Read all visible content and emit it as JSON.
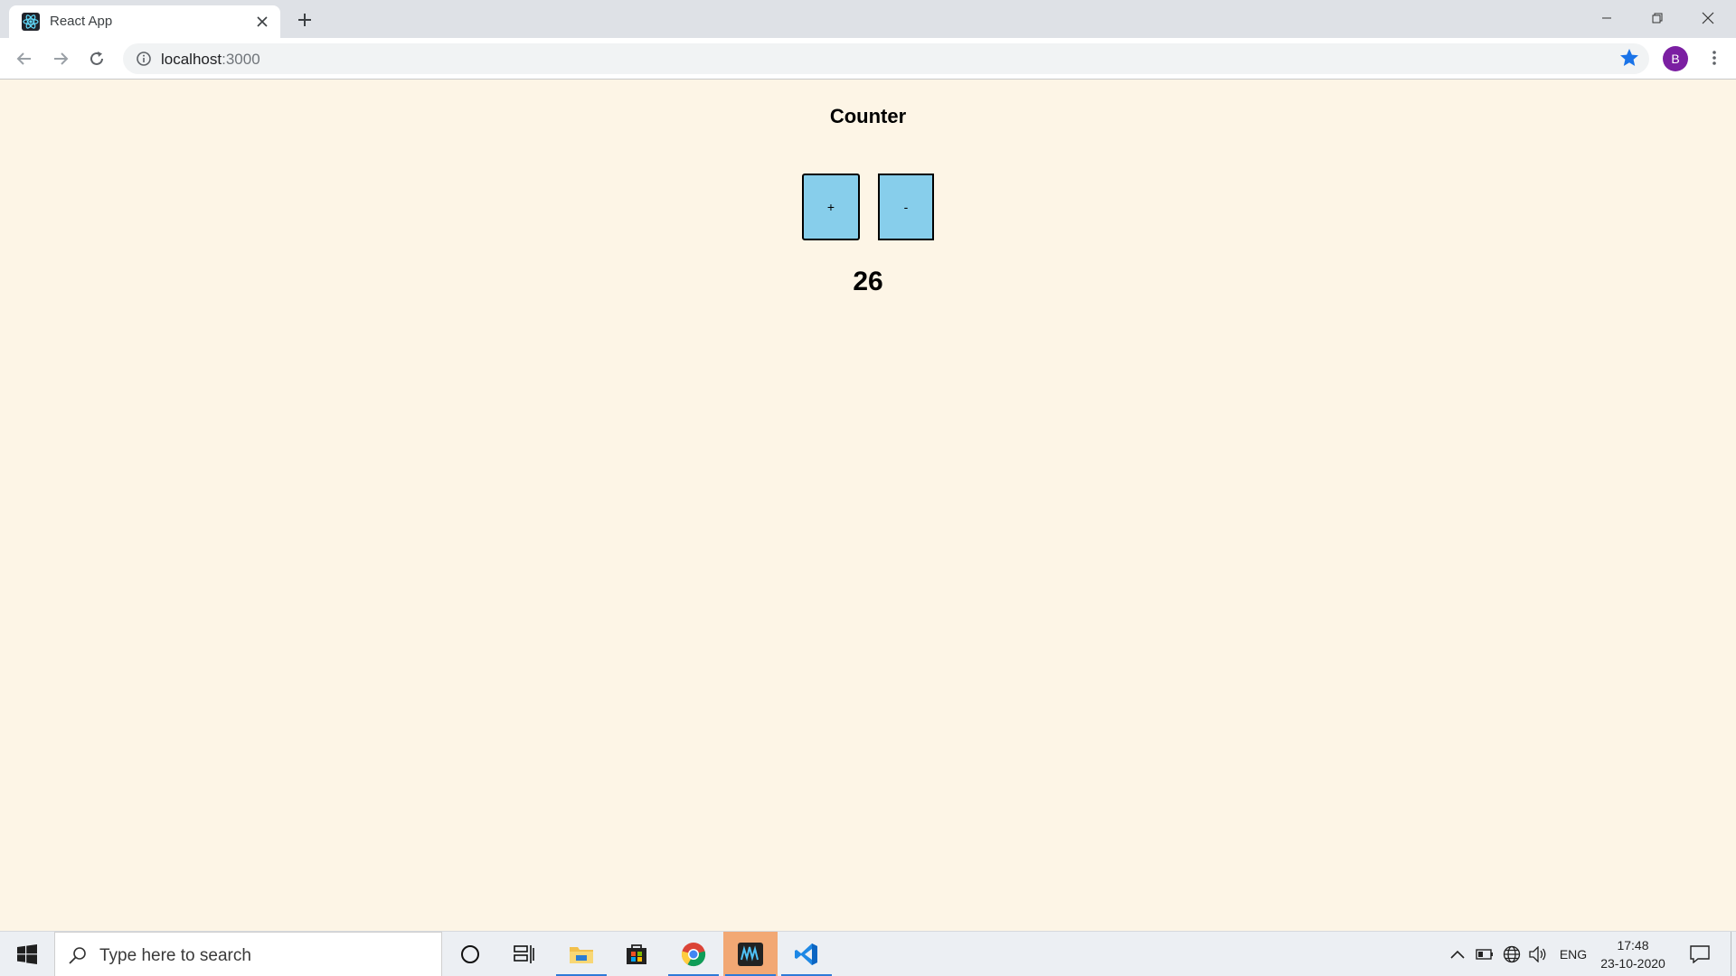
{
  "browser": {
    "tab_title": "React App",
    "url_host": "localhost",
    "url_port": ":3000",
    "profile_initial": "B",
    "accent": "#1a73e8",
    "profile_color": "#7b1fa2"
  },
  "app": {
    "heading": "Counter",
    "increment_label": "+",
    "decrement_label": "-",
    "count": "26",
    "button_color": "#87ceeb",
    "background_color": "#fdf5e6"
  },
  "taskbar": {
    "search_placeholder": "Type here to search",
    "pinned": [
      "cortana-icon",
      "task-view-icon",
      "file-explorer-icon",
      "store-icon",
      "chrome-icon",
      "waves-app-icon",
      "vscode-icon"
    ],
    "language": "ENG",
    "time": "17:48",
    "date": "23-10-2020"
  }
}
